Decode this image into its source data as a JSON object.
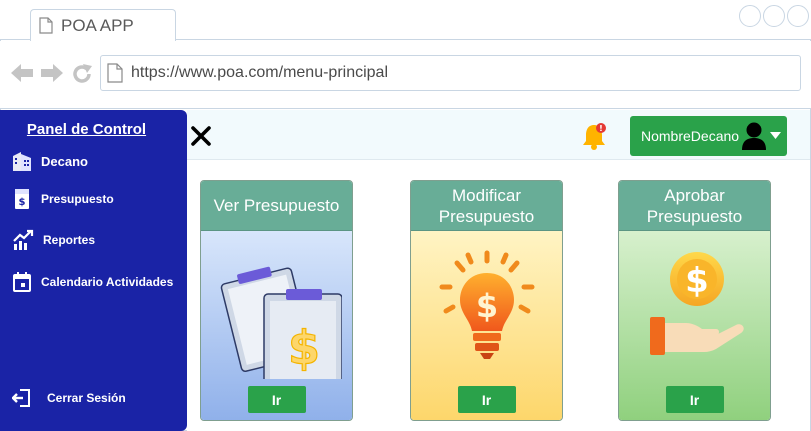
{
  "browser": {
    "tab_title": "POA APP",
    "url": "https://www.poa.com/menu-principal"
  },
  "sidebar": {
    "title": "Panel de Control",
    "items": [
      {
        "label": "Decano",
        "icon": "building-icon"
      },
      {
        "label": "Presupuesto",
        "icon": "budget-document-icon"
      },
      {
        "label": "Reportes",
        "icon": "chart-up-icon"
      },
      {
        "label": "Calendario Actividades",
        "icon": "calendar-icon"
      }
    ],
    "logout": {
      "label": "Cerrar Sesión",
      "icon": "logout-icon"
    }
  },
  "header": {
    "user_name": "NombreDecano",
    "notification_badge": "!"
  },
  "cards": [
    {
      "title": "Ver Presupuesto",
      "button": "Ir",
      "icon": "clipboard-dollar-icon"
    },
    {
      "title": "Modificar Presupuesto",
      "button": "Ir",
      "icon": "lightbulb-dollar-icon"
    },
    {
      "title": "Aprobar Presupuesto",
      "button": "Ir",
      "icon": "hand-coin-icon"
    }
  ],
  "colors": {
    "sidebar": "#1a23a6",
    "button_green": "#2aa24a",
    "card_header": "#68ad97"
  }
}
